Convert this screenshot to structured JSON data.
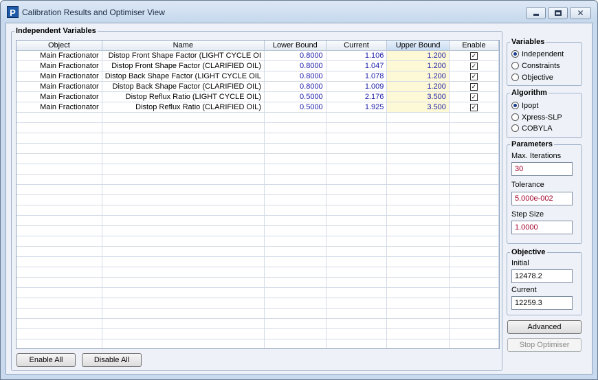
{
  "window": {
    "title": "Calibration Results and Optimiser View",
    "app_icon": "P"
  },
  "independent_variables": {
    "legend": "Independent Variables",
    "columns": [
      "Object",
      "Name",
      "Lower Bound",
      "Current",
      "Upper Bound",
      "Enable"
    ],
    "rows": [
      {
        "object": "Main Fractionator",
        "name": "Distop Front Shape Factor (LIGHT CYCLE OI",
        "lower": "0.8000",
        "current": "1.106",
        "upper": "1.200",
        "enable": true
      },
      {
        "object": "Main Fractionator",
        "name": "Distop Front Shape Factor (CLARIFIED OIL)",
        "lower": "0.8000",
        "current": "1.047",
        "upper": "1.200",
        "enable": true
      },
      {
        "object": "Main Fractionator",
        "name": "Distop Back Shape Factor (LIGHT CYCLE OIL",
        "lower": "0.8000",
        "current": "1.078",
        "upper": "1.200",
        "enable": true
      },
      {
        "object": "Main Fractionator",
        "name": "Distop Back Shape Factor (CLARIFIED OIL)",
        "lower": "0.8000",
        "current": "1.009",
        "upper": "1.200",
        "enable": true
      },
      {
        "object": "Main Fractionator",
        "name": "Distop Reflux Ratio (LIGHT CYCLE OIL)",
        "lower": "0.5000",
        "current": "2.176",
        "upper": "3.500",
        "enable": true
      },
      {
        "object": "Main Fractionator",
        "name": "Distop Reflux Ratio (CLARIFIED OIL)",
        "lower": "0.5000",
        "current": "1.925",
        "upper": "3.500",
        "enable": true
      }
    ],
    "enable_all_label": "Enable All",
    "disable_all_label": "Disable All"
  },
  "variables": {
    "legend": "Variables",
    "options": [
      "Independent",
      "Constraints",
      "Objective"
    ],
    "selected": "Independent"
  },
  "algorithm": {
    "legend": "Algorithm",
    "options": [
      "Ipopt",
      "Xpress-SLP",
      "COBYLA"
    ],
    "selected": "Ipopt"
  },
  "parameters": {
    "legend": "Parameters",
    "max_iterations_label": "Max. Iterations",
    "max_iterations": "30",
    "tolerance_label": "Tolerance",
    "tolerance": "5.000e-002",
    "step_size_label": "Step Size",
    "step_size": "1.0000"
  },
  "objective": {
    "legend": "Objective",
    "initial_label": "Initial",
    "initial": "12478.2",
    "current_label": "Current",
    "current": "12259.3"
  },
  "buttons": {
    "advanced": "Advanced",
    "stop_optimiser": "Stop Optimiser"
  }
}
